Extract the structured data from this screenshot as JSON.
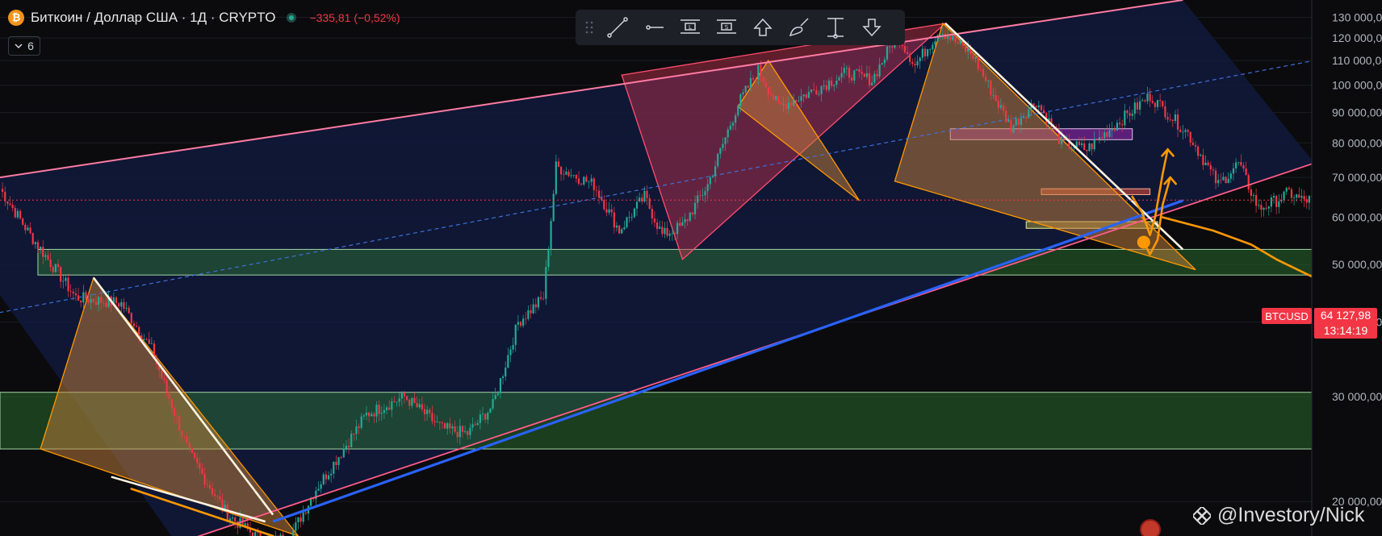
{
  "header": {
    "coin_icon": "bitcoin-icon",
    "coin_glyph": "₿",
    "symbol": "Биткоин / Доллар США · 1Д · CRYPTO",
    "change": "−335,81 (−0,52%)"
  },
  "indicators": {
    "icon": "chevron-down-icon",
    "count": "6"
  },
  "toolbar": {
    "tools": [
      "trend-line-icon",
      "horizontal-line-icon",
      "long-position-icon",
      "short-position-icon",
      "arrow-up-icon",
      "brush-icon",
      "measure-icon",
      "arrow-down-icon"
    ]
  },
  "price_axis": {
    "labels": [
      "130 000,00",
      "120 000,00",
      "110 000,00",
      "100 000,00",
      "90 000,00",
      "80 000,00",
      "70 000,00",
      "60 000,00",
      "50 000,00",
      "40 000,00",
      "30 000,00",
      "20 000,00"
    ]
  },
  "current_price": {
    "ticker": "BTCUSD",
    "value": "64 127,98",
    "countdown": "13:14:19"
  },
  "watermark": {
    "icon": "tradingview-logo-icon",
    "text": "@Investory/Nick"
  },
  "colors": {
    "background": "#0b0b0e",
    "up": "#22ab94",
    "down": "#f23645",
    "channel": "#ff6f91",
    "support_line": "#2962ff",
    "orange": "#ff9800",
    "zone_green": "#2e7d32",
    "zone_purple": "#9c27b0"
  },
  "chart_data": {
    "type": "candlestick",
    "y_scale": "log",
    "ylim": [
      17500,
      139000
    ],
    "x_count": 520,
    "y_ticks": [
      130000,
      120000,
      110000,
      100000,
      90000,
      80000,
      70000,
      60000,
      50000,
      40000,
      30000,
      20000
    ],
    "current_price": 64127.98,
    "path_anchors": [
      [
        0,
        67000
      ],
      [
        12,
        56000
      ],
      [
        30,
        44000
      ],
      [
        48,
        43000
      ],
      [
        60,
        36000
      ],
      [
        75,
        24000
      ],
      [
        90,
        19000
      ],
      [
        105,
        17000
      ],
      [
        115,
        17500
      ],
      [
        125,
        21000
      ],
      [
        130,
        22500
      ],
      [
        145,
        28000
      ],
      [
        160,
        30000
      ],
      [
        175,
        26500
      ],
      [
        185,
        26000
      ],
      [
        195,
        29000
      ],
      [
        205,
        40000
      ],
      [
        215,
        44000
      ],
      [
        220,
        73000
      ],
      [
        235,
        68000
      ],
      [
        245,
        57000
      ],
      [
        255,
        65000
      ],
      [
        262,
        56000
      ],
      [
        270,
        58000
      ],
      [
        280,
        68000
      ],
      [
        292,
        93000
      ],
      [
        300,
        106000
      ],
      [
        308,
        92000
      ],
      [
        320,
        97000
      ],
      [
        335,
        105000
      ],
      [
        345,
        102000
      ],
      [
        355,
        122000
      ],
      [
        362,
        108000
      ],
      [
        372,
        124000
      ],
      [
        385,
        112000
      ],
      [
        392,
        98000
      ],
      [
        400,
        85000
      ],
      [
        410,
        94000
      ],
      [
        420,
        80000
      ],
      [
        430,
        78000
      ],
      [
        440,
        85000
      ],
      [
        455,
        96000
      ],
      [
        470,
        83000
      ],
      [
        482,
        68000
      ],
      [
        490,
        74000
      ],
      [
        498,
        62000
      ],
      [
        505,
        64000
      ],
      [
        510,
        66000
      ],
      [
        515,
        64128
      ]
    ],
    "drawings": {
      "channel_top": [
        [
          -30,
          67000
        ],
        [
          468,
          139000
        ]
      ],
      "channel_bottom": [
        [
          70,
          17000
        ],
        [
          520,
          74000
        ]
      ],
      "midline_dashed": [
        [
          -20,
          40000
        ],
        [
          520,
          110000
        ]
      ],
      "support_blue": [
        [
          108,
          18500
        ],
        [
          468,
          64000
        ]
      ],
      "zones": [
        {
          "color": "green",
          "x": [
            15,
            520
          ],
          "y": [
            48000,
            53000
          ]
        },
        {
          "color": "green",
          "x": [
            0,
            520
          ],
          "y": [
            24500,
            30500
          ]
        },
        {
          "color": "purple",
          "x": [
            376,
            448
          ],
          "y": [
            81000,
            84500
          ]
        },
        {
          "color": "red",
          "x": [
            412,
            455
          ],
          "y": [
            65500,
            67000
          ]
        },
        {
          "color": "olive",
          "x": [
            406,
            458
          ],
          "y": [
            57500,
            59000
          ]
        }
      ],
      "triangles": [
        {
          "color": "orange",
          "points": [
            [
              16,
              24500
            ],
            [
              37,
              47500
            ],
            [
              118,
              17500
            ]
          ]
        },
        {
          "color": "red",
          "points": [
            [
              246,
              104000
            ],
            [
              270,
              51000
            ],
            [
              374,
              127000
            ]
          ]
        },
        {
          "color": "orange",
          "points": [
            [
              292,
              92000
            ],
            [
              304,
              110000
            ],
            [
              340,
              64000
            ]
          ]
        },
        {
          "color": "orange",
          "points": [
            [
              354,
              69000
            ],
            [
              373,
              127000
            ],
            [
              473,
              49000
            ]
          ]
        }
      ],
      "white_trendlines": [
        [
          [
            37,
            47500
          ],
          [
            108,
            19000
          ]
        ],
        [
          [
            44,
            22000
          ],
          [
            105,
            18500
          ]
        ],
        [
          [
            374,
            127000
          ],
          [
            468,
            53000
          ]
        ]
      ],
      "orange_scribbles": [
        [
          [
            52,
            21000
          ],
          [
            108,
            17500
          ]
        ],
        [
          [
            460,
            60000
          ],
          [
            480,
            57000
          ],
          [
            495,
            54000
          ],
          [
            505,
            51000
          ],
          [
            520,
            47500
          ]
        ],
        [
          [
            448,
            65000
          ],
          [
            452,
            61000
          ],
          [
            455,
            56000
          ],
          [
            457,
            60000
          ],
          [
            460,
            71000
          ],
          [
            462,
            78000
          ]
        ],
        [
          [
            452,
            55000
          ],
          [
            455,
            52000
          ],
          [
            458,
            55000
          ],
          [
            460,
            63000
          ],
          [
            463,
            70000
          ]
        ]
      ]
    }
  }
}
